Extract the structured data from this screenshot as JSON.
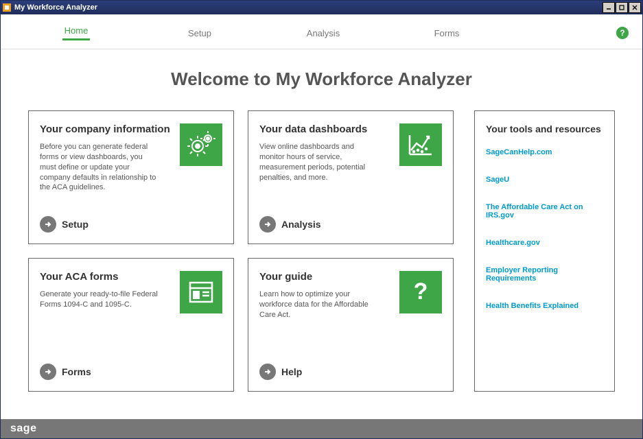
{
  "window": {
    "title": "My Workforce Analyzer"
  },
  "tabs": [
    {
      "label": "Home",
      "active": true
    },
    {
      "label": "Setup",
      "active": false
    },
    {
      "label": "Analysis",
      "active": false
    },
    {
      "label": "Forms",
      "active": false
    }
  ],
  "page_title": "Welcome to My Workforce Analyzer",
  "cards": [
    {
      "title": "Your company information",
      "desc": "Before you can generate federal forms or view dashboards, you must define or update your company defaults in relationship to the ACA guidelines.",
      "action": "Setup",
      "icon": "gears"
    },
    {
      "title": "Your data dashboards",
      "desc": "View online dashboards and monitor hours of service, measurement periods, potential penalties, and more.",
      "action": "Analysis",
      "icon": "chart"
    },
    {
      "title": "Your ACA forms",
      "desc": "Generate your ready-to-file Federal Forms 1094-C and 1095-C.",
      "action": "Forms",
      "icon": "window"
    },
    {
      "title": "Your guide",
      "desc": "Learn how to optimize your workforce data for the Affordable Care Act.",
      "action": "Help",
      "icon": "question"
    }
  ],
  "resources": {
    "title": "Your tools and resources",
    "links": [
      "SageCanHelp.com",
      "SageU",
      "The Affordable Care Act on IRS.gov",
      "Healthcare.gov",
      "Employer Reporting Requirements",
      "Health Benefits Explained"
    ]
  },
  "footer": {
    "logo": "sage"
  }
}
